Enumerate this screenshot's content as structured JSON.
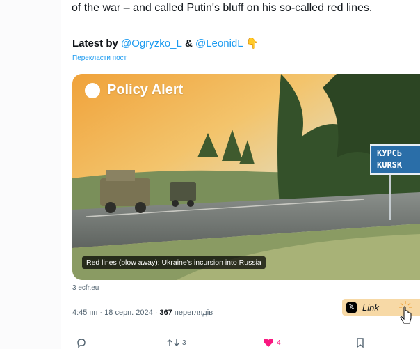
{
  "tweet": {
    "intro_text": "of the war – and called Putin's bluff on his so-called red lines.",
    "latest_prefix": "Latest by ",
    "mention_1": "@Ogryzko_L",
    "mention_joiner": " & ",
    "mention_2": "@LeonidL",
    "pointing_emoji": "👇",
    "translate_label": "Перекласти пост",
    "card": {
      "badge_label": "Policy Alert",
      "caption": "Red lines (blow away): Ukraine's incursion into Russia",
      "sign_line_1": "КУРСЬ",
      "sign_line_2": "KURSK",
      "domain": "3 ecfr.eu"
    },
    "timestamp": "4:45 пп · 18 серп. 2024 · ",
    "views_count": "367",
    "views_label": " переглядів"
  },
  "overlay": {
    "link_label": "Link"
  },
  "actions": {
    "reply_count": "",
    "retweet_count": "3",
    "like_count": "4",
    "bookmark_count": ""
  },
  "colors": {
    "accent_blue": "#1d9bf0",
    "like_pink": "#f91880",
    "muted_text": "#536471",
    "link_button_bg": "#f7d9a6"
  }
}
